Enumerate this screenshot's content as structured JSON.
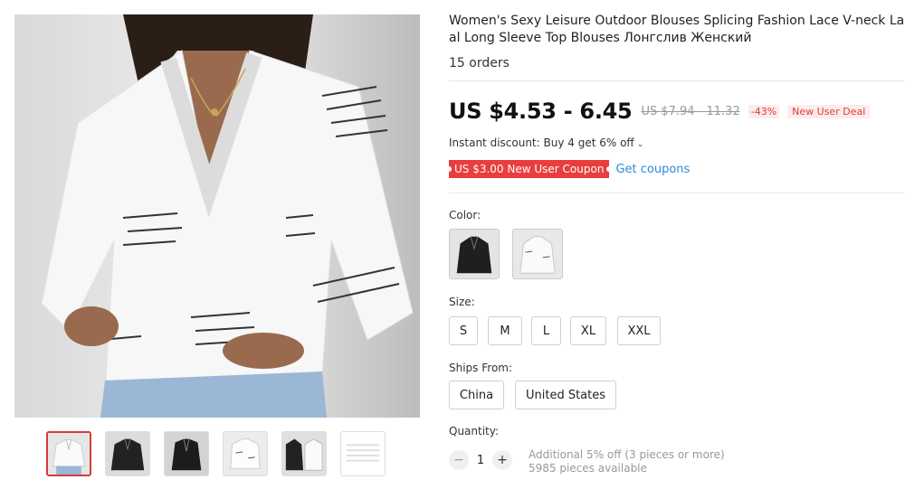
{
  "product": {
    "title_line1": "Women's Sexy Leisure Outdoor Blouses Splicing Fashion Lace V-neck Lace Prin",
    "title_line2": "al Long Sleeve Top Blouses Лонгслив Женский",
    "orders": "15 orders"
  },
  "pricing": {
    "price": "US $4.53 - 6.45",
    "old_price": "US $7.94 - 11.32",
    "discount": "-43%",
    "deal_badge": "New User Deal",
    "instant_discount": "Instant discount: Buy 4 get 6% off",
    "coupon": "US $3.00 New User Coupon",
    "get_coupons": "Get coupons"
  },
  "options": {
    "color_label": "Color:",
    "size_label": "Size:",
    "sizes": [
      "S",
      "M",
      "L",
      "XL",
      "XXL"
    ],
    "ships_label": "Ships From:",
    "ships_from": [
      "China",
      "United States"
    ],
    "quantity_label": "Quantity:",
    "quantity_value": "1",
    "quantity_minus": "−",
    "quantity_plus": "+",
    "additional_discount": "Additional 5% off (3 pieces or more)",
    "available": "5985 pieces available"
  },
  "colors": {
    "accent_red": "#ea3d3d",
    "link_blue": "#2d8cd9"
  }
}
